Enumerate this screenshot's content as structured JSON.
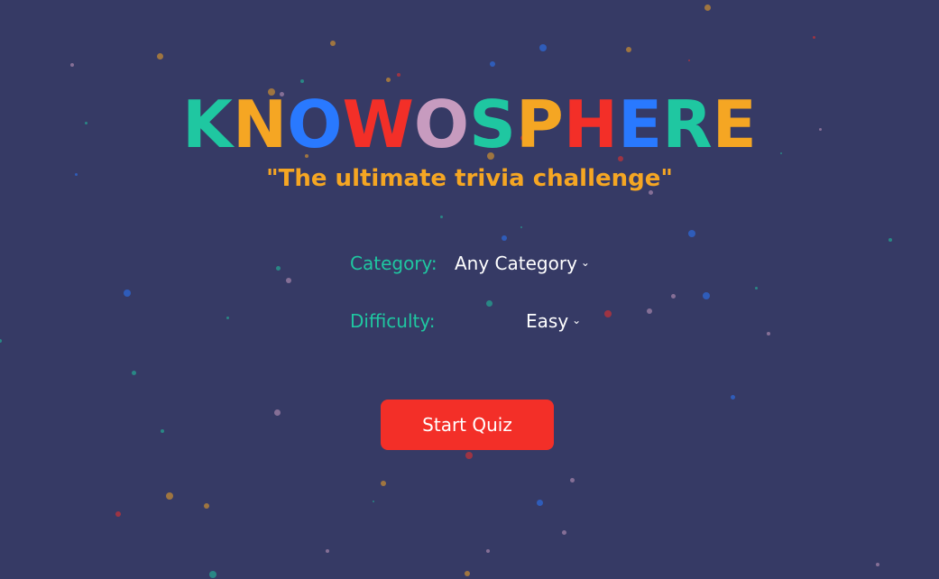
{
  "title": {
    "letters": [
      {
        "char": "K",
        "color": "#1fc7a1"
      },
      {
        "char": "N",
        "color": "#f5a623"
      },
      {
        "char": "O",
        "color": "#2979ff"
      },
      {
        "char": "W",
        "color": "#f32f28"
      },
      {
        "char": "O",
        "color": "#c79bbf"
      },
      {
        "char": "S",
        "color": "#1fc7a1"
      },
      {
        "char": "P",
        "color": "#f5a623"
      },
      {
        "char": "H",
        "color": "#f32f28"
      },
      {
        "char": "E",
        "color": "#2979ff"
      },
      {
        "char": "R",
        "color": "#1fc7a1"
      },
      {
        "char": "E",
        "color": "#f5a623"
      }
    ]
  },
  "tagline": "\"The ultimate trivia challenge\"",
  "form": {
    "category_label": "Category:",
    "category_value": "Any Category",
    "difficulty_label": "Difficulty:",
    "difficulty_value": "Easy"
  },
  "start_button": "Start Quiz",
  "colors": {
    "background": "#363a65",
    "accent_teal": "#1fc7a1",
    "accent_orange": "#f5a623",
    "accent_blue": "#2979ff",
    "accent_red": "#f32f28",
    "accent_pink": "#c79bbf",
    "button": "#f32f28"
  }
}
